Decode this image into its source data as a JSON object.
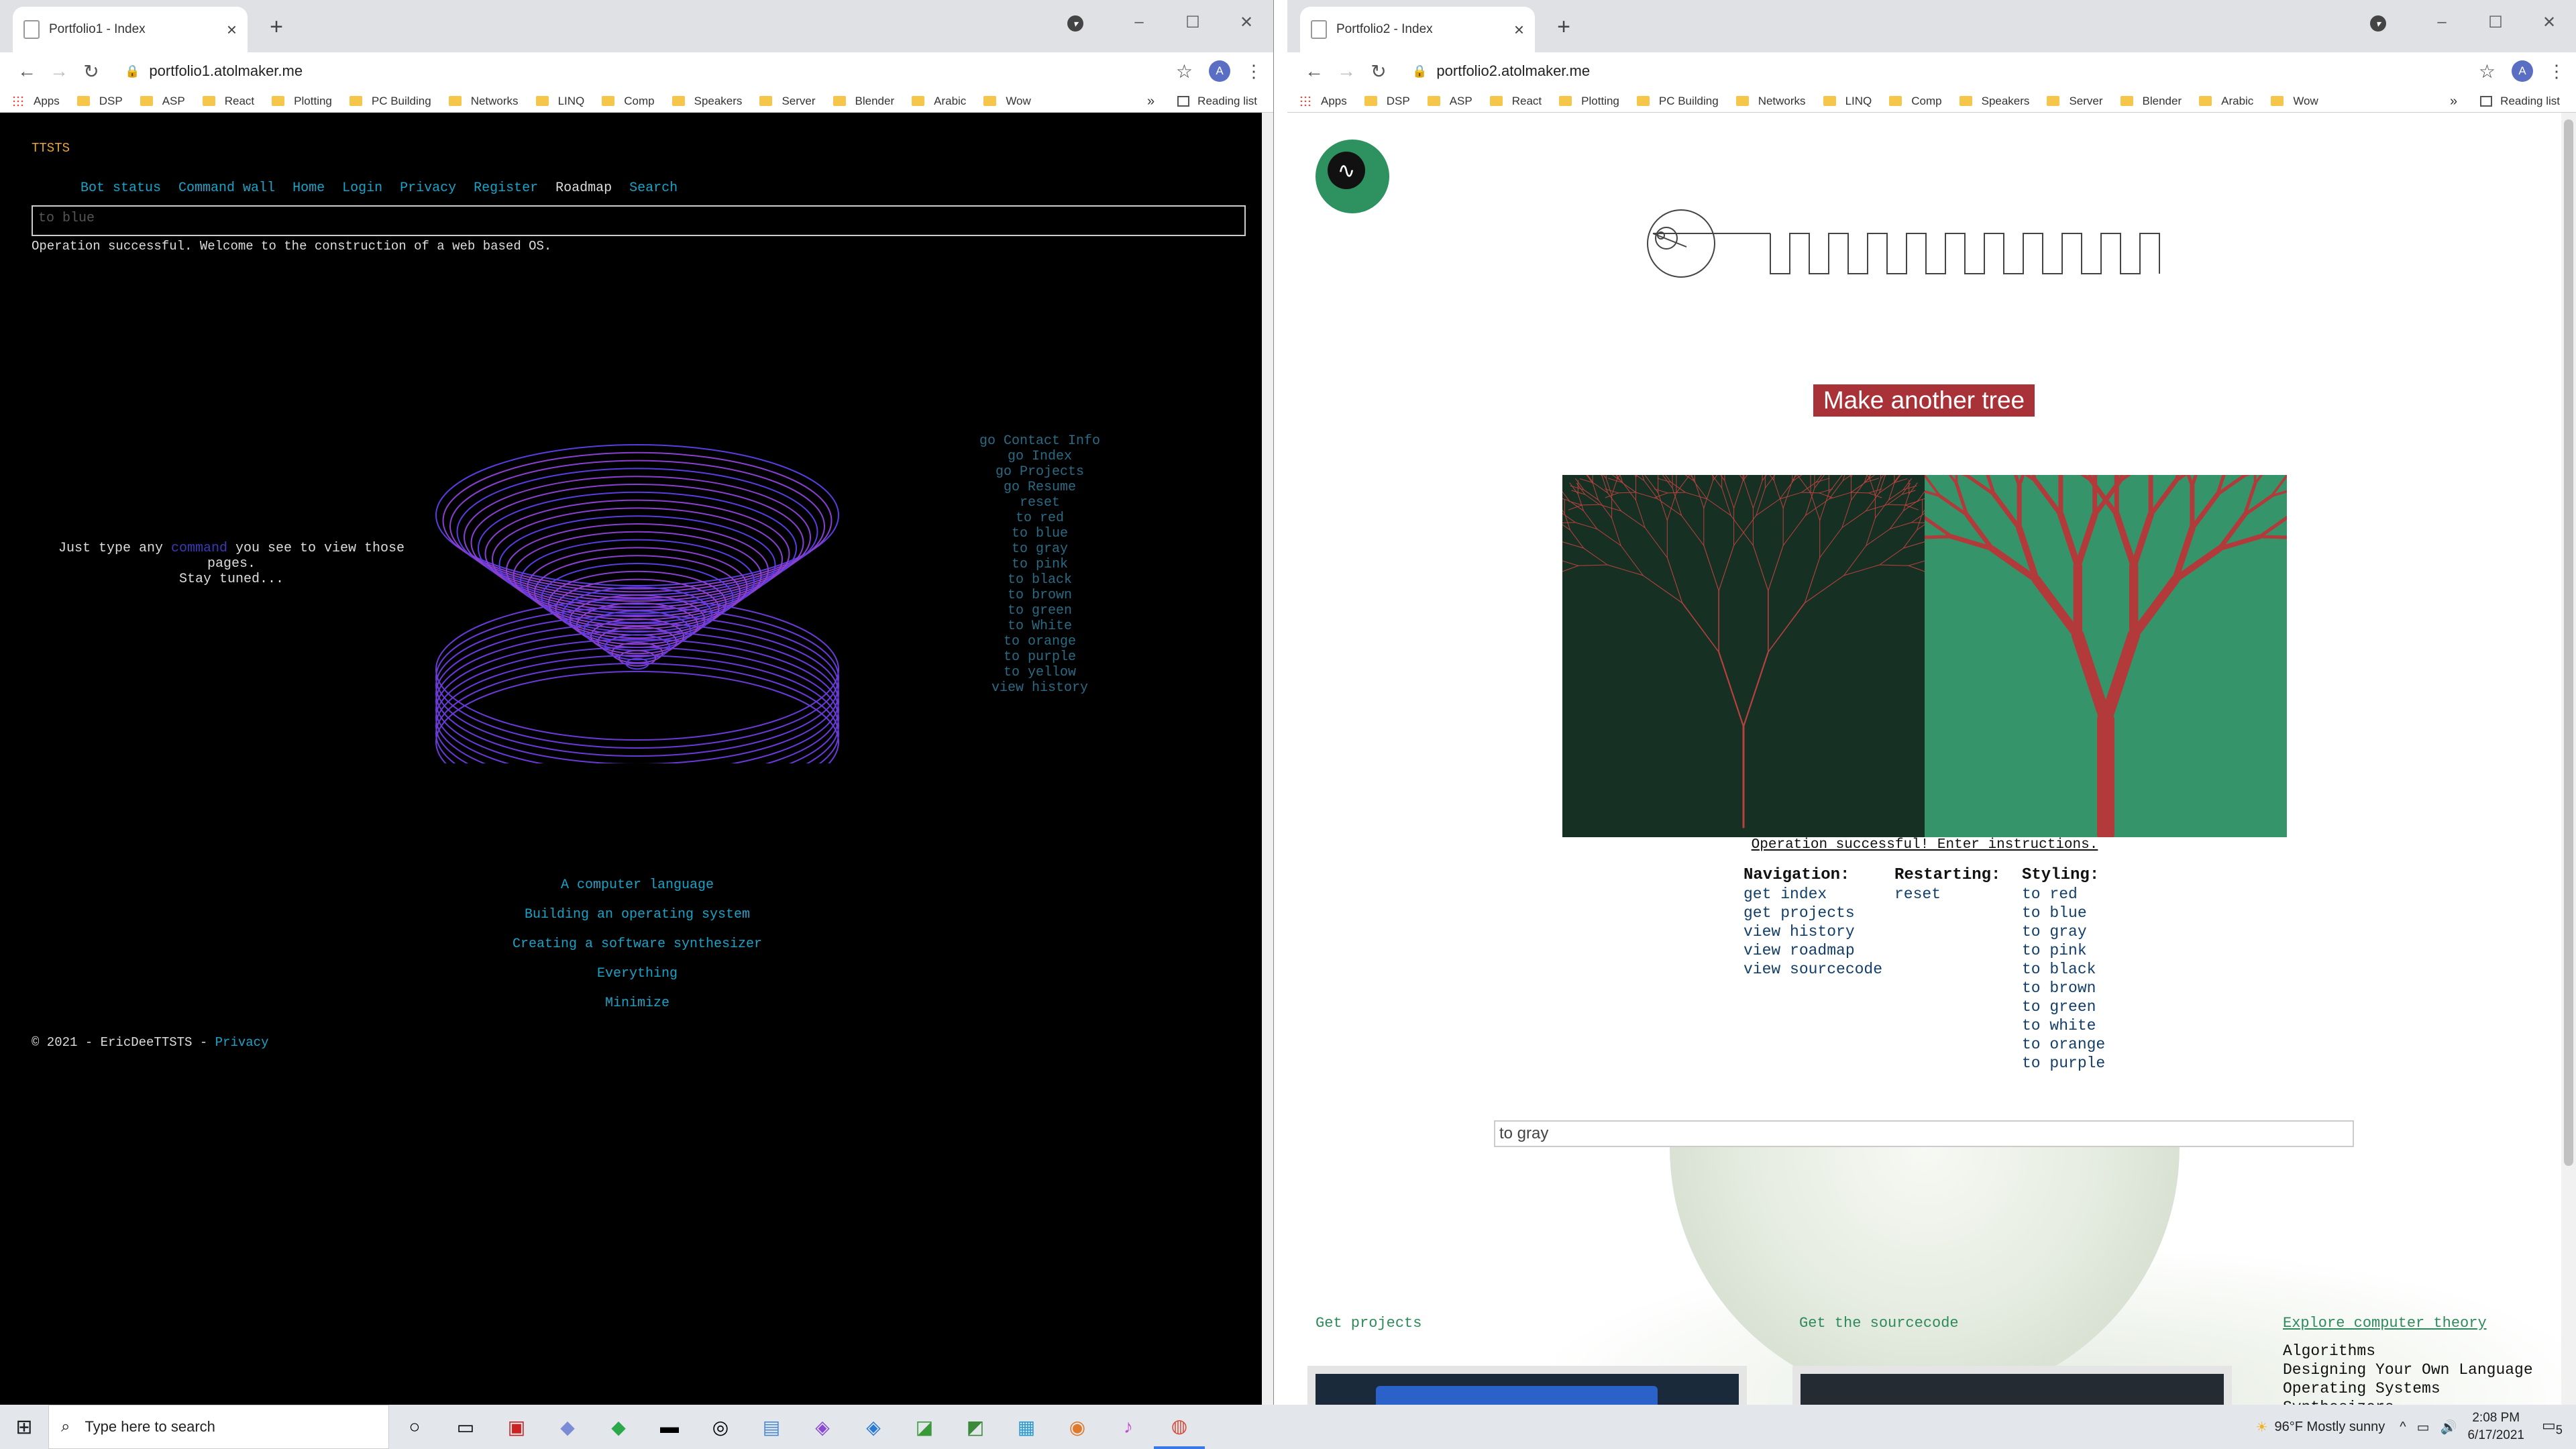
{
  "bookmarks": [
    "Apps",
    "DSP",
    "ASP",
    "React",
    "Plotting",
    "PC Building",
    "Networks",
    "LINQ",
    "Comp",
    "Speakers",
    "Server",
    "Blender",
    "Arabic",
    "Wow"
  ],
  "bookmarks_more": "»",
  "reading_list": "Reading list",
  "profile_initial": "A",
  "left": {
    "tab_title": "Portfolio1 - Index",
    "url": "portfolio1.atolmaker.me",
    "brand": "TTSTS",
    "nav": [
      "Bot status",
      "Command wall",
      "Home",
      "Login",
      "Privacy",
      "Register",
      "Roadmap",
      "Search"
    ],
    "nav_active": "Roadmap",
    "command_value": "to blue",
    "status": "Operation successful. Welcome to the construction of a web based OS.",
    "type_line1_pre": "Just type any ",
    "type_line1_link": "command",
    "type_line1_post": " you see to view those",
    "type_line2": "pages.",
    "type_line3": "Stay tuned...",
    "commands": [
      "go Contact Info",
      "go Index",
      "go Projects",
      "go Resume",
      "reset",
      "to red",
      "to blue",
      "to gray",
      "to pink",
      "to black",
      "to brown",
      "to green",
      "to White",
      "to orange",
      "to purple",
      "to yellow",
      "view history"
    ],
    "projects": [
      "A computer language",
      "Building an operating system",
      "Creating a software synthesizer",
      "Everything",
      "Minimize"
    ],
    "footer_text": "© 2021 - EricDeeTTSTS - ",
    "footer_link": "Privacy"
  },
  "right": {
    "tab_title": "Portfolio2 - Index",
    "url": "portfolio2.atolmaker.me",
    "logo_glyph": "∿",
    "make_tree_button": "Make another tree",
    "status": "Operation successful! Enter instructions.",
    "navigation_heading": "Navigation:",
    "navigation": [
      "get index",
      "get projects",
      "view history",
      "view roadmap",
      "view sourcecode"
    ],
    "restarting_heading": "Restarting:",
    "restarting": [
      "reset"
    ],
    "styling_heading": "Styling:",
    "styling": [
      "to red",
      "to blue",
      "to gray",
      "to pink",
      "to black",
      "to brown",
      "to green",
      "to white",
      "to orange",
      "to purple"
    ],
    "input_value": "to gray",
    "link_projects": "Get projects",
    "link_sourcecode": "Get the sourcecode",
    "link_theory": "Explore computer theory",
    "theory_items": [
      "Algorithms",
      "Designing Your Own Language",
      "Operating Systems",
      "Synthesizers"
    ]
  },
  "taskbar": {
    "search_placeholder": "Type here to search",
    "weather": "96°F  Mostly sunny",
    "time": "2:08 PM",
    "date": "6/17/2021",
    "notification_count": "5"
  },
  "colors": {
    "left_link": "#1aa3c8",
    "brand": "#e8a53a",
    "tree_button": "#a83237",
    "tree_bg_left": "#163124",
    "tree_bg_right": "#35946a",
    "green_link": "#2e8a5a"
  }
}
